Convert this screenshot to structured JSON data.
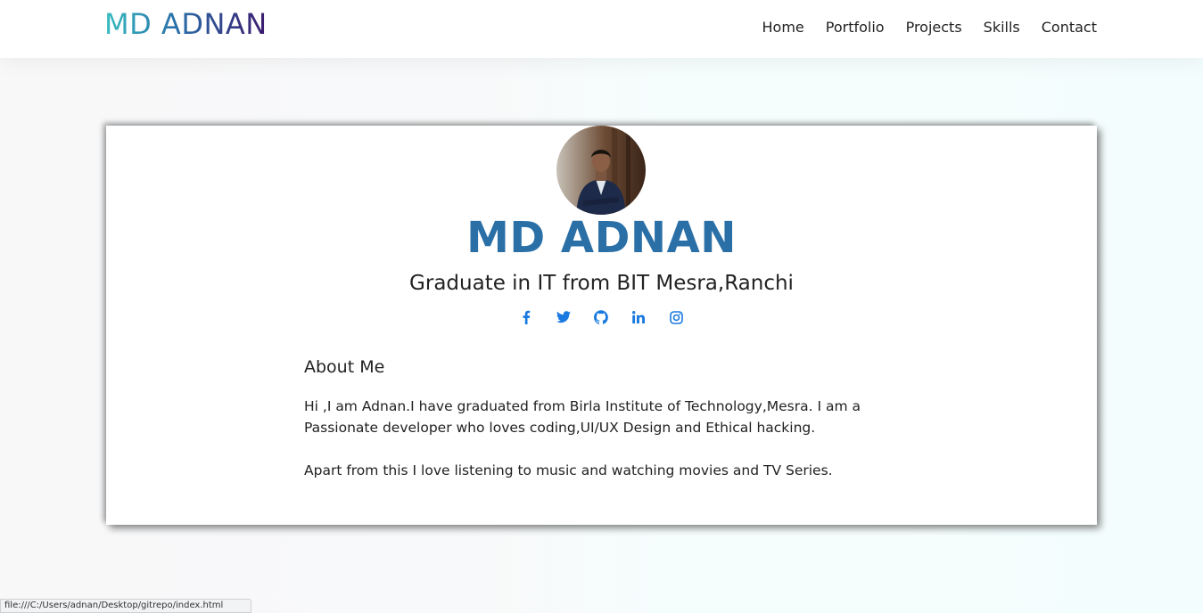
{
  "navbar": {
    "brand": "MD ADNAN",
    "links": [
      "Home",
      "Portfolio",
      "Projects",
      "Skills",
      "Contact"
    ]
  },
  "profile": {
    "name": "MD ADNAN",
    "subtitle": "Graduate in IT from BIT Mesra,Ranchi",
    "social": [
      "facebook-icon",
      "twitter-icon",
      "github-icon",
      "linkedin-icon",
      "instagram-icon"
    ]
  },
  "about": {
    "title": "About Me",
    "paragraph1": "Hi ,I am Adnan.I have graduated from Birla Institute of Technology,Mesra. I am a Passionate developer who loves coding,UI/UX Design and Ethical hacking.",
    "paragraph2": "Apart from this I love listening to music and watching movies and TV Series."
  },
  "statusbar": {
    "url": "file:///C:/Users/adnan/Desktop/gitrepo/index.html"
  },
  "colors": {
    "accent": "#2a6fa6",
    "link_icon": "#1a7ae0"
  }
}
